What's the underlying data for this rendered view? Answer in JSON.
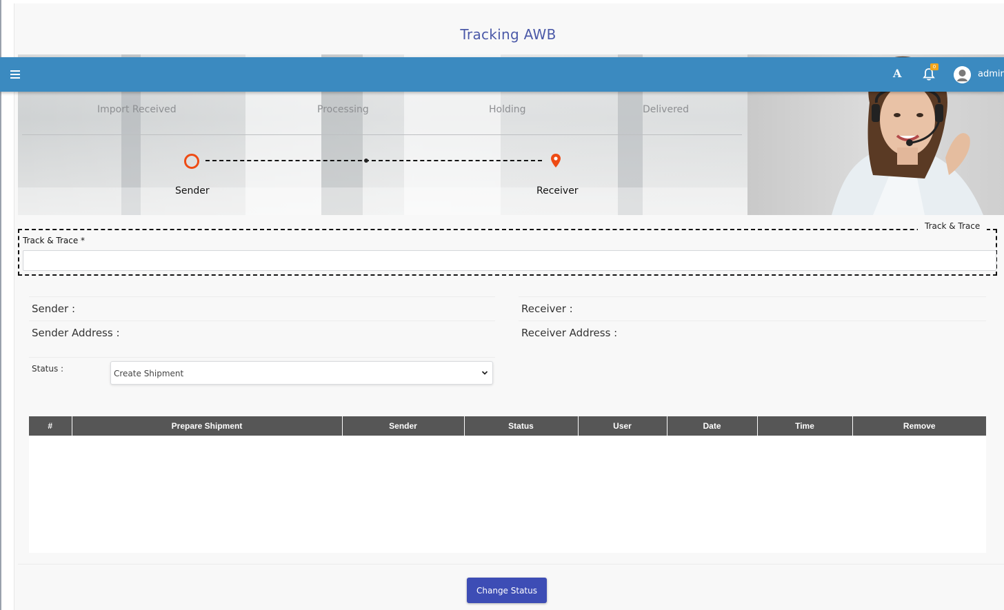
{
  "page": {
    "title": "Tracking AWB"
  },
  "topbar": {
    "font_button": "A",
    "notification_count": "0",
    "username": "admin"
  },
  "hero": {
    "stages": [
      "Import Received",
      "Processing",
      "Holding",
      "Delivered"
    ],
    "sender_label": "Sender",
    "receiver_label": "Receiver"
  },
  "trace": {
    "legend": "Track & Trace",
    "label": "Track & Trace *",
    "value": "",
    "placeholder": ""
  },
  "info": {
    "sender": "Sender :",
    "sender_address": "Sender Address :",
    "receiver": "Receiver :",
    "receiver_address": "Receiver Address :"
  },
  "status": {
    "label": "Status :",
    "selected": "Create Shipment"
  },
  "table": {
    "headers": [
      "#",
      "Prepare Shipment",
      "Sender",
      "Status",
      "User",
      "Date",
      "Time",
      "Remove"
    ],
    "rows": []
  },
  "actions": {
    "change_status": "Change Status"
  },
  "colors": {
    "topbar": "#3b8ac0",
    "title": "#4b59a8",
    "accent_orange": "#ee4b14",
    "button": "#3d4db5",
    "table_header": "#565656"
  }
}
